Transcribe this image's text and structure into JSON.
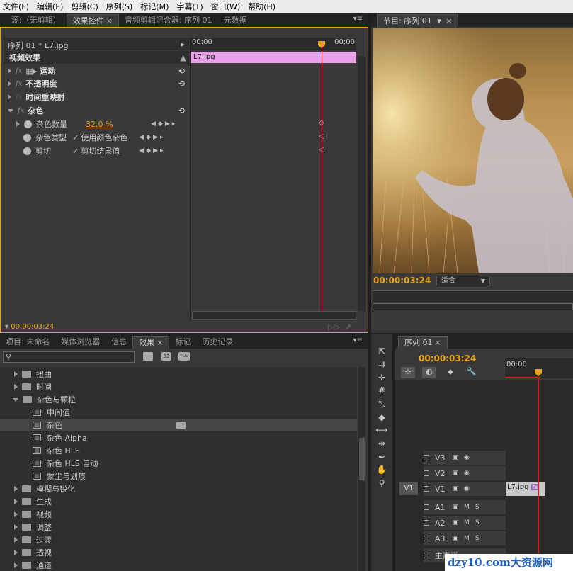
{
  "menu": [
    "文件(F)",
    "编辑(E)",
    "剪辑(C)",
    "序列(S)",
    "标记(M)",
    "字幕(T)",
    "窗口(W)",
    "帮助(H)"
  ],
  "top_tabs": {
    "source": "源:（无剪辑）",
    "effect_controls": "效果控件",
    "audio_mixer": "音频剪辑混合器: 序列 01",
    "metadata": "元数据",
    "close": "×",
    "menu": "▾≡"
  },
  "program_tab": {
    "label": "节目: 序列 01",
    "dropdown": "▾",
    "close": "×"
  },
  "effect_controls": {
    "clip_path": "序列 01 * L7.jpg",
    "ruler_start": "00:00",
    "ruler_end": "00:00",
    "clip_name": "L7.jpg",
    "video_effects": "视频效果",
    "motion": "运动",
    "opacity": "不透明度",
    "time_remap": "时间重映射",
    "noise": "杂色",
    "params": [
      {
        "name": "杂色数量",
        "value": "32.0 %"
      },
      {
        "name": "杂色类型",
        "value": "使用颜色杂色"
      },
      {
        "name": "剪切",
        "value": "剪切结果值"
      }
    ],
    "timecode": "00:00:03:24",
    "reset_icon": "reset-icon"
  },
  "program": {
    "timecode": "00:00:03:24",
    "fit": "适合"
  },
  "project_tabs": {
    "project": "项目: 未命名",
    "media_browser": "媒体浏览器",
    "info": "信息",
    "effects": "效果",
    "markers": "标记",
    "history": "历史记录"
  },
  "effects_tree": [
    {
      "label": "扭曲",
      "type": "folder"
    },
    {
      "label": "时间",
      "type": "folder"
    },
    {
      "label": "杂色与颗粒",
      "type": "folder-open"
    },
    {
      "label": "中间值",
      "type": "effect"
    },
    {
      "label": "杂色",
      "type": "effect-selected"
    },
    {
      "label": "杂色 Alpha",
      "type": "effect"
    },
    {
      "label": "杂色 HLS",
      "type": "effect"
    },
    {
      "label": "杂色 HLS 自动",
      "type": "effect"
    },
    {
      "label": "蒙尘与划痕",
      "type": "effect"
    },
    {
      "label": "模糊与锐化",
      "type": "folder"
    },
    {
      "label": "生成",
      "type": "folder"
    },
    {
      "label": "视频",
      "type": "folder"
    },
    {
      "label": "调整",
      "type": "folder"
    },
    {
      "label": "过渡",
      "type": "folder"
    },
    {
      "label": "透视",
      "type": "folder"
    },
    {
      "label": "通道",
      "type": "folder"
    }
  ],
  "effects_filter_icons": [
    "32",
    "YUV"
  ],
  "timeline": {
    "tab": "序列 01",
    "timecode": "00:00:03:24",
    "ruler": "00:00",
    "tracks": [
      {
        "name": "V3"
      },
      {
        "name": "V2"
      },
      {
        "name": "V1",
        "source": "V1",
        "clip": "L7.jpg"
      },
      {
        "name": "A1"
      },
      {
        "name": "A2"
      },
      {
        "name": "A3"
      },
      {
        "name": "主声道"
      }
    ],
    "track_btns": {
      "mute": "M",
      "solo": "S"
    }
  },
  "watermark": "dzy10.com大资源网",
  "colors": {
    "accent": "#e8a317",
    "clip_pink": "#e8a0e8",
    "playhead": "#d02020"
  }
}
